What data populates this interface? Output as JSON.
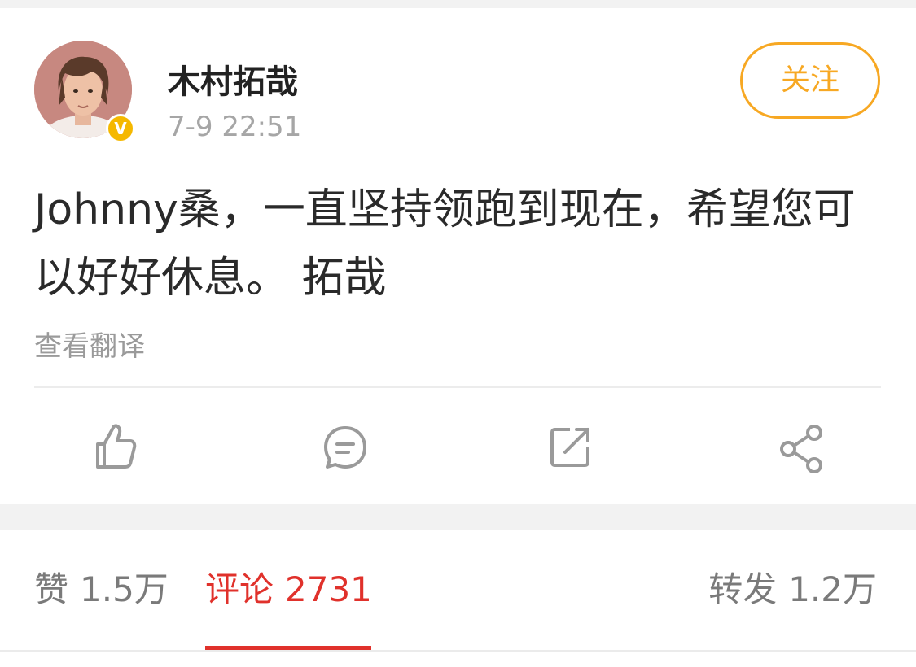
{
  "post": {
    "author_name": "木村拓哉",
    "verified_badge": "V",
    "timestamp": "7-9 22:51",
    "follow_label": "关注",
    "text": "Johnny桑，一直坚持领跑到现在，希望您可以好好休息。 拓哉",
    "translate_label": "查看翻译"
  },
  "actions": [
    {
      "icon": "thumbs-up-icon"
    },
    {
      "icon": "comment-icon"
    },
    {
      "icon": "repost-icon"
    },
    {
      "icon": "share-icon"
    }
  ],
  "tabs": {
    "likes_label": "赞",
    "likes_count": "1.5万",
    "comments_label": "评论",
    "comments_count": "2731",
    "reposts_label": "转发",
    "reposts_count": "1.2万",
    "active": "comments"
  },
  "colors": {
    "accent_orange": "#f7a823",
    "active_red": "#e0312b",
    "verified_gold": "#f5b800",
    "icon_gray": "#9a9a9a"
  }
}
